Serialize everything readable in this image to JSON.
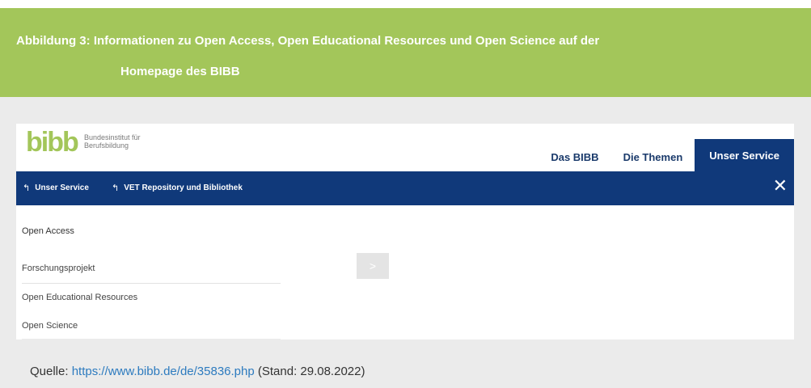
{
  "figure": {
    "caption_line1": "Abbildung 3: Informationen zu Open Access, Open Educational Resources und Open Science auf der",
    "caption_line2": "Homepage des BIBB"
  },
  "site": {
    "logo_text": "bibb",
    "org_name_line1": "Bundesinstitut für",
    "org_name_line2": "Berufsbildung",
    "logo_color": "#a3c65a",
    "nav": [
      "Das BIBB",
      "Die Themen",
      "Unser Service"
    ],
    "active_nav": "Unser Service",
    "breadcrumbs": [
      "Unser Service",
      "VET Repository und Bibliothek"
    ],
    "menu_items": [
      "Open Access",
      "Forschungsprojekt",
      "Open Educational Resources",
      "Open Science"
    ],
    "arrow_button": ">",
    "close_icon": "close-icon",
    "colors": {
      "nav_blue": "#10397a",
      "caption_green": "#a3c65a",
      "link_blue": "#2d7bbf"
    }
  },
  "source": {
    "prefix": "Quelle: ",
    "url": "https://www.bibb.de/de/35836.php",
    "suffix": " (Stand: 29.08.2022)"
  }
}
